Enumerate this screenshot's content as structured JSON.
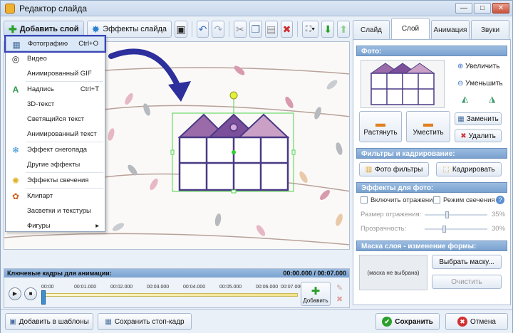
{
  "window": {
    "title": "Редактор слайда",
    "minimize": "—",
    "maximize": "□",
    "close": "✕"
  },
  "toolbar": {
    "add_layer": "Добавить слой",
    "slide_effects": "Эффекты слайда"
  },
  "menu": {
    "items": [
      {
        "label": "Фотографию",
        "shortcut": "Ctrl+O",
        "icon": "photo-icon"
      },
      {
        "label": "Видео",
        "shortcut": "",
        "icon": "video-icon"
      },
      {
        "label": "Анимированный GIF",
        "shortcut": "",
        "icon": "gif-icon"
      },
      {
        "label": "Надпись",
        "shortcut": "Ctrl+T",
        "icon": "text-icon"
      },
      {
        "label": "3D-текст",
        "shortcut": "",
        "icon": "text3d-icon"
      },
      {
        "label": "Светящийся текст",
        "shortcut": "",
        "icon": "glow-text-icon"
      },
      {
        "label": "Анимированный текст",
        "shortcut": "",
        "icon": "anim-text-icon"
      },
      {
        "label": "Эффект снегопада",
        "shortcut": "",
        "icon": "snowflake-icon"
      },
      {
        "label": "Другие эффекты",
        "shortcut": "",
        "icon": "effects-icon"
      },
      {
        "label": "Эффекты свечения",
        "shortcut": "",
        "icon": "glow-icon"
      },
      {
        "label": "Клипарт",
        "shortcut": "",
        "icon": "clipart-icon"
      },
      {
        "label": "Засветки и текстуры",
        "shortcut": "",
        "icon": "texture-icon"
      },
      {
        "label": "Фигуры",
        "shortcut": "",
        "icon": "shapes-icon",
        "arrow": "▸"
      }
    ]
  },
  "tabs": [
    "Слайд",
    "Слой",
    "Анимация",
    "Звуки"
  ],
  "photo": {
    "header": "Фото:",
    "zoom_in": "Увеличить",
    "zoom_out": "Уменьшить",
    "stretch": "Растянуть",
    "fit": "Уместить",
    "replace": "Заменить",
    "delete": "Удалить"
  },
  "filters": {
    "header": "Фильтры и кадрирование:",
    "photo_filters": "Фото фильтры",
    "crop": "Кадрировать"
  },
  "effects": {
    "header": "Эффекты для фото:",
    "reflection": "Включить отражение",
    "glow_mode": "Режим свечения",
    "help": "?",
    "reflection_size": "Размер отражения:",
    "reflection_size_val": "35%",
    "transparency": "Прозрачность:",
    "transparency_val": "30%",
    "reflection_level": 35,
    "transparency_level": 30
  },
  "mask": {
    "header": "Маска слоя - изменение формы:",
    "placeholder": "(маска не выбрана)",
    "choose": "Выбрать маску...",
    "clear": "Очистить"
  },
  "timeline": {
    "header": "Ключевые кадры для анимации:",
    "time": "00:00.000 / 00:07.000",
    "ticks": [
      "00:00",
      "00:01.000",
      "00:02.000",
      "00:03.000",
      "00:04.000",
      "00:05.000",
      "00:06.000",
      "00:07.000"
    ],
    "add": "Добавить"
  },
  "bottom": {
    "add_templates": "Добавить в шаблоны",
    "save_frame": "Сохранить стоп-кадр",
    "save": "Сохранить",
    "cancel": "Отмена"
  }
}
